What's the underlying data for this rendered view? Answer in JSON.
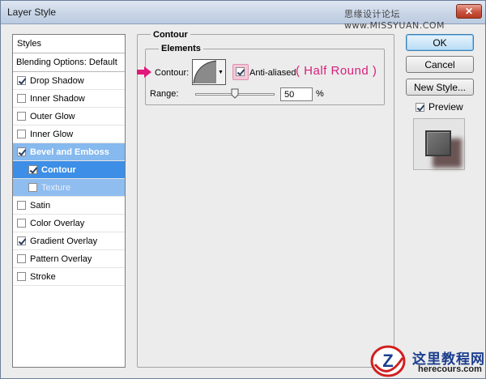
{
  "window": {
    "title": "Layer Style",
    "watermark": "思缘设计论坛 www.MISSYUAN.COM",
    "close_symbol": "✕"
  },
  "styles_panel": {
    "header": "Styles",
    "blending": "Blending Options: Default",
    "items": [
      {
        "label": "Drop Shadow",
        "checked": true
      },
      {
        "label": "Inner Shadow",
        "checked": false
      },
      {
        "label": "Outer Glow",
        "checked": false
      },
      {
        "label": "Inner Glow",
        "checked": false
      },
      {
        "label": "Bevel and Emboss",
        "checked": true
      },
      {
        "label": "Contour",
        "checked": true
      },
      {
        "label": "Texture",
        "checked": false
      },
      {
        "label": "Satin",
        "checked": false
      },
      {
        "label": "Color Overlay",
        "checked": false
      },
      {
        "label": "Gradient Overlay",
        "checked": true
      },
      {
        "label": "Pattern Overlay",
        "checked": false
      },
      {
        "label": "Stroke",
        "checked": false
      }
    ]
  },
  "contour": {
    "group_title": "Contour",
    "elements_title": "Elements",
    "contour_label": "Contour:",
    "anti_aliased_label": "Anti-aliased",
    "anti_aliased": true,
    "annotation": "( Half Round )",
    "annotation_color": "#d6207b",
    "range_label": "Range:",
    "range_value": "50",
    "range_unit": "%",
    "range_fraction": 0.5
  },
  "buttons": {
    "ok": "OK",
    "cancel": "Cancel",
    "new_style": "New Style...",
    "preview_label": "Preview",
    "preview_checked": true
  },
  "logo": {
    "letter": "Z",
    "name_cn": "这里教程网",
    "domain": "herecours.com"
  },
  "colors": {
    "selection_light": "#86b9ee",
    "selection_dark": "#3d8ee6",
    "accent_arrow": "#e0197a"
  }
}
